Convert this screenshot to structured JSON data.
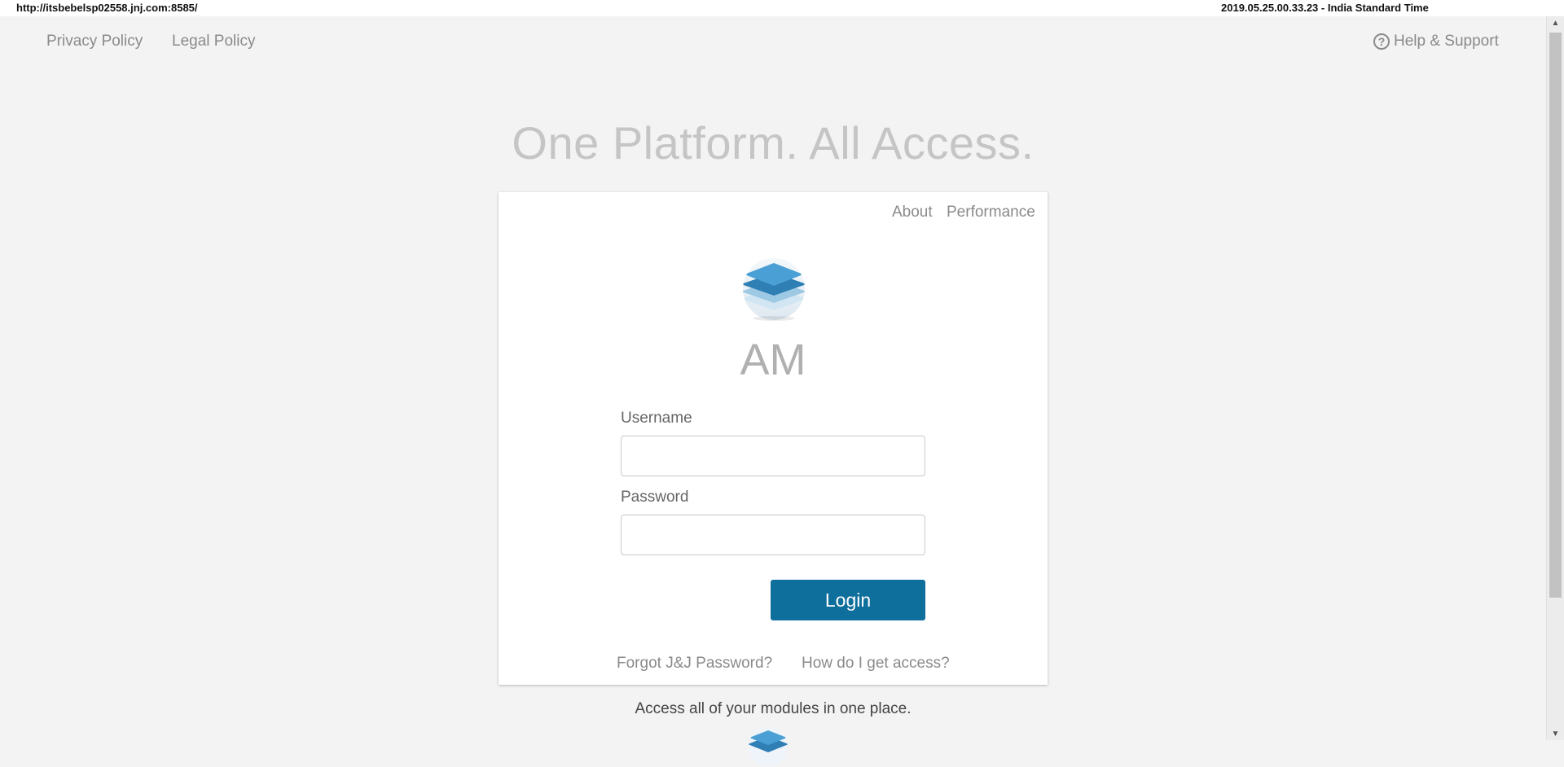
{
  "topbar": {
    "url": "http://itsbebelsp02558.jnj.com:8585/",
    "timestamp": "2019.05.25.00.33.23 - India Standard Time"
  },
  "nav": {
    "privacy": "Privacy Policy",
    "legal": "Legal Policy",
    "help": "Help & Support",
    "help_icon": "question-circle-icon"
  },
  "headline": "One Platform. All Access.",
  "card": {
    "about": "About",
    "performance": "Performance",
    "app_name": "AM",
    "username_label": "Username",
    "username_value": "",
    "password_label": "Password",
    "password_value": "",
    "login_label": "Login",
    "forgot_link": "Forgot J&J Password?",
    "access_link": "How do I get access?"
  },
  "tagline": "Access all of your modules in one place.",
  "colors": {
    "accent": "#0e6e9c",
    "background": "#f3f3f3",
    "headline": "#c5c5c5"
  }
}
